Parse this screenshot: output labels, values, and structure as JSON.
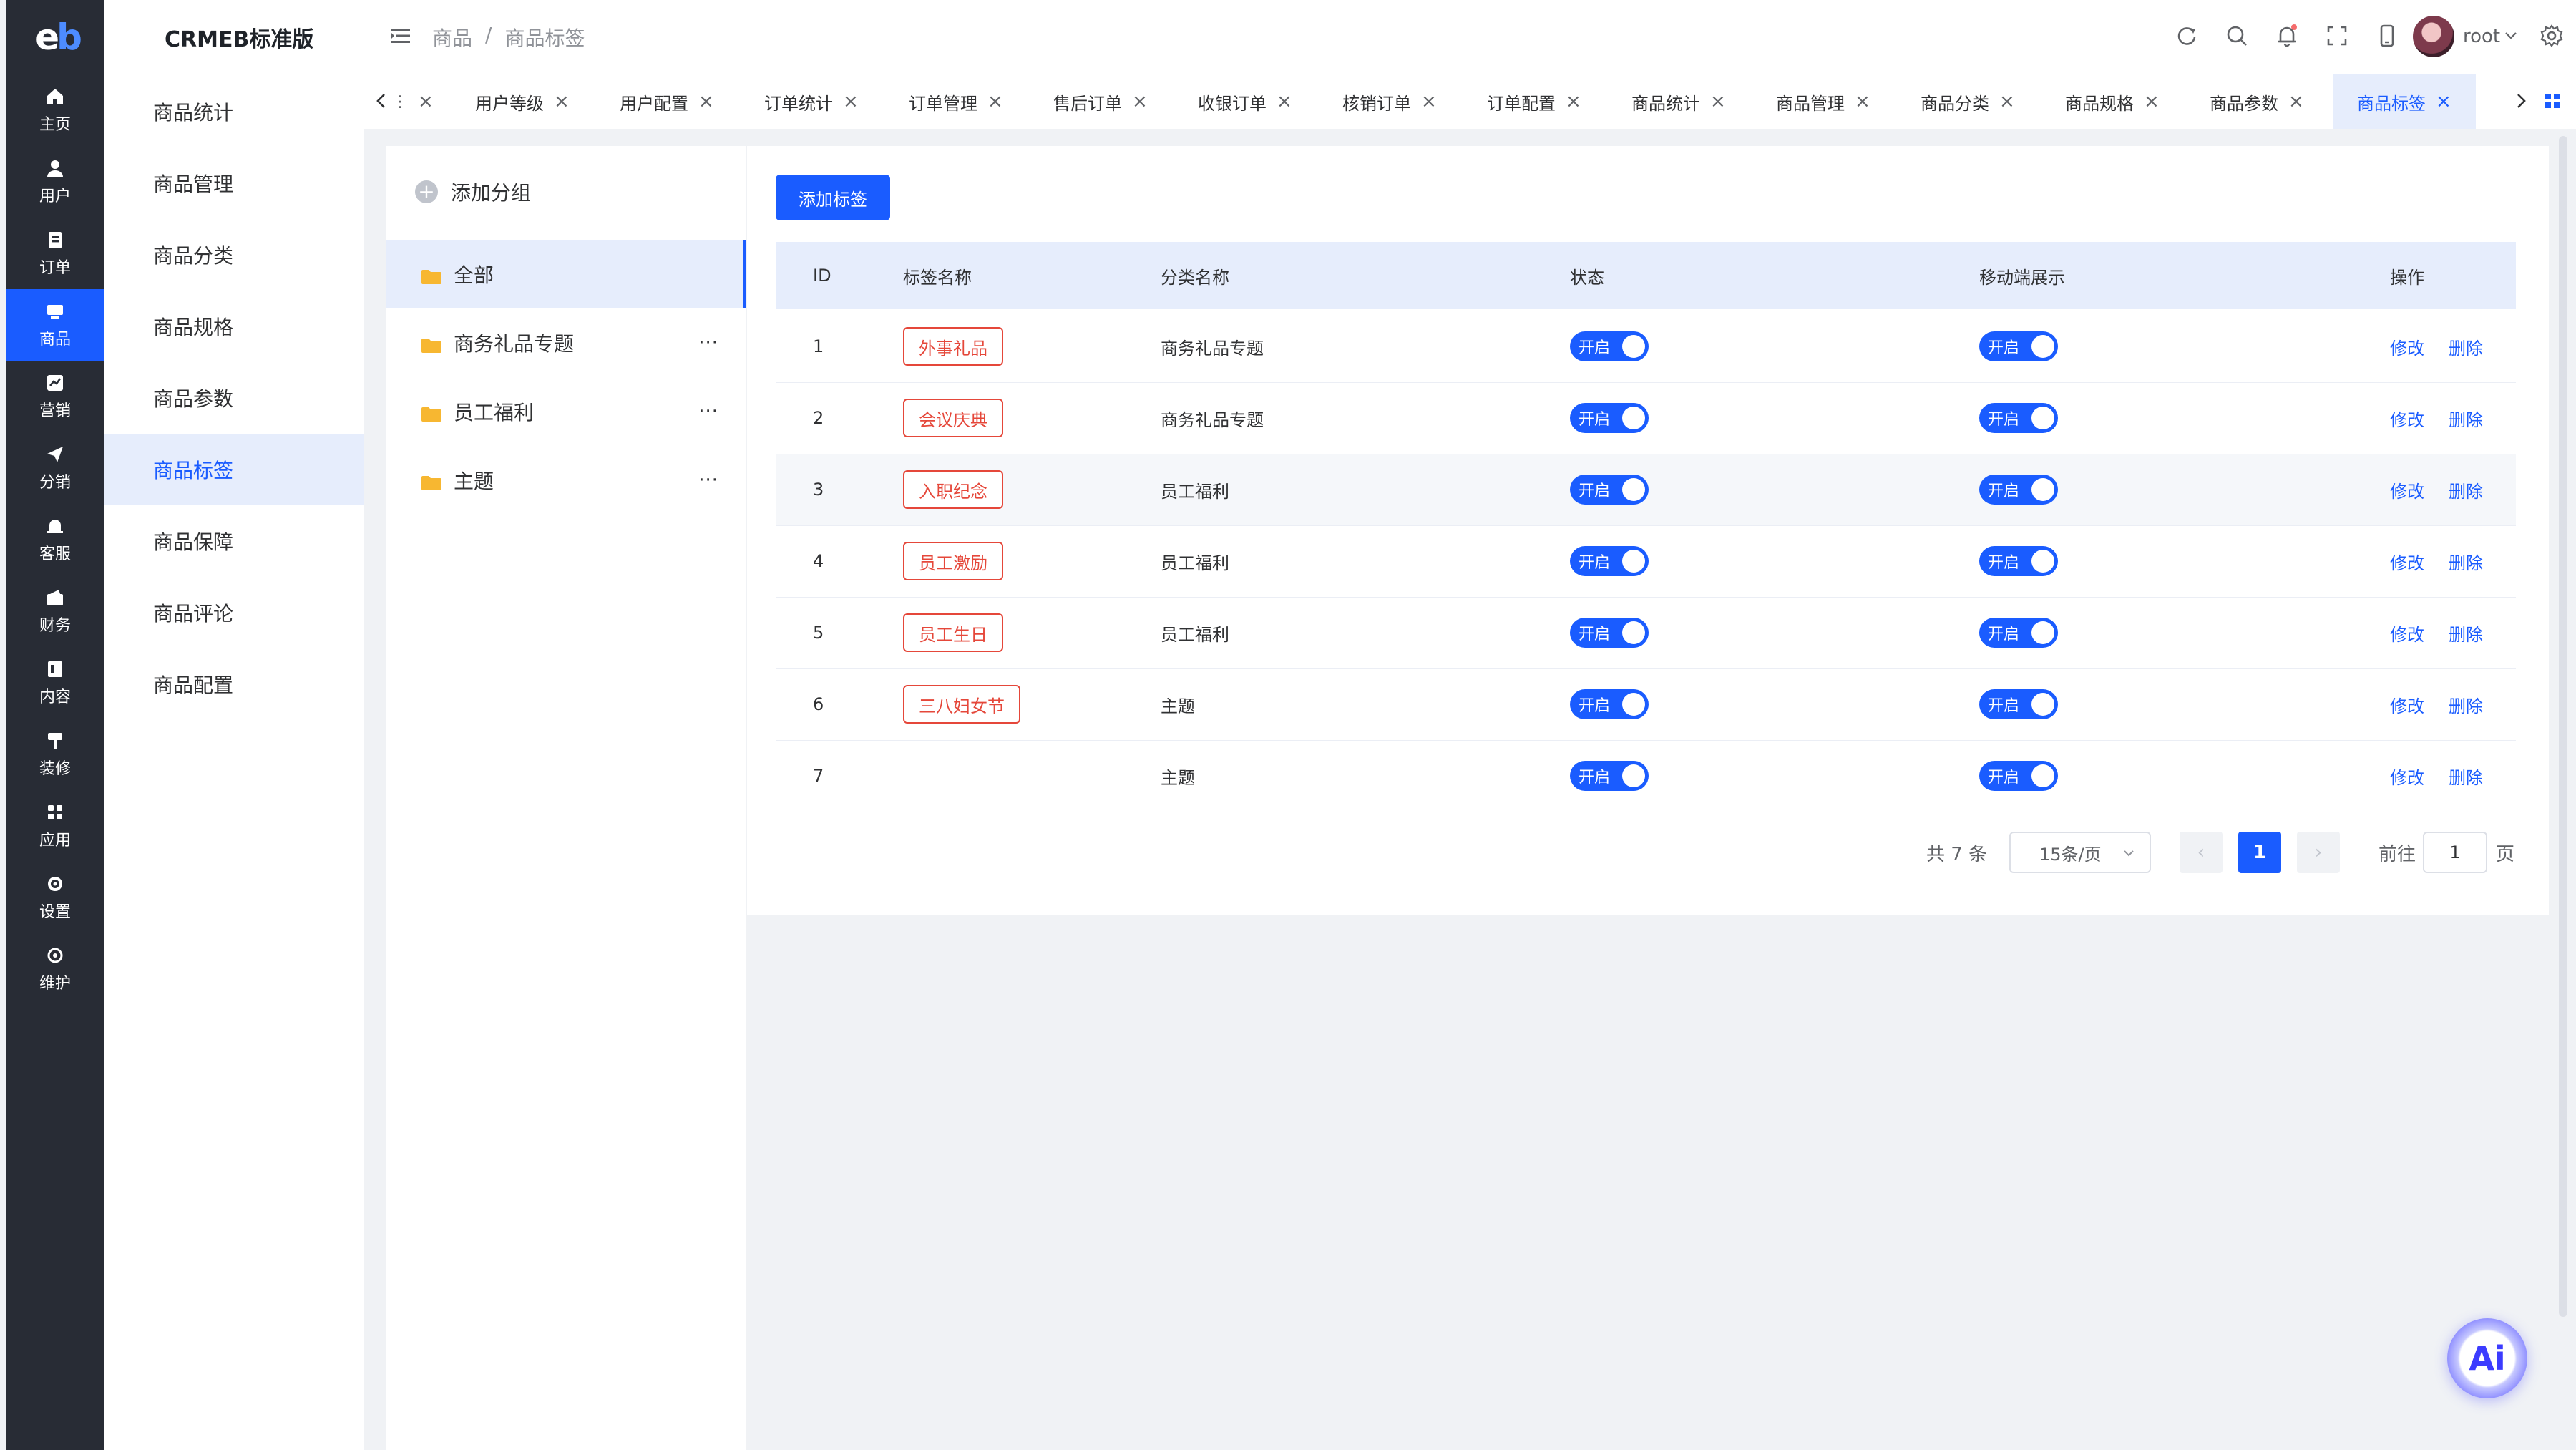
{
  "left_nav": {
    "logo": "eb",
    "items": [
      {
        "label": "主页",
        "icon": "home-icon"
      },
      {
        "label": "用户",
        "icon": "user-icon"
      },
      {
        "label": "订单",
        "icon": "order-icon"
      },
      {
        "label": "商品",
        "icon": "product-icon",
        "active": true
      },
      {
        "label": "营销",
        "icon": "marketing-icon"
      },
      {
        "label": "分销",
        "icon": "distribution-icon"
      },
      {
        "label": "客服",
        "icon": "service-icon"
      },
      {
        "label": "财务",
        "icon": "finance-icon"
      },
      {
        "label": "内容",
        "icon": "content-icon"
      },
      {
        "label": "装修",
        "icon": "decoration-icon"
      },
      {
        "label": "应用",
        "icon": "apps-icon"
      },
      {
        "label": "设置",
        "icon": "settings-icon"
      },
      {
        "label": "维护",
        "icon": "maintenance-icon"
      }
    ]
  },
  "submenu": {
    "brand": "CRMEB标准版",
    "items": [
      "商品统计",
      "商品管理",
      "商品分类",
      "商品规格",
      "商品参数",
      "商品标签",
      "商品保障",
      "商品评论",
      "商品配置"
    ],
    "active": "商品标签"
  },
  "header": {
    "breadcrumb": [
      "商品",
      "/",
      "商品标签"
    ],
    "username": "root",
    "icons": [
      "refresh-icon",
      "search-icon",
      "bell-icon",
      "fullscreen-icon",
      "mobile-icon",
      "settings-icon"
    ]
  },
  "tabs": {
    "items": [
      "用户等级",
      "用户配置",
      "订单统计",
      "订单管理",
      "售后订单",
      "收银订单",
      "核销订单",
      "订单配置",
      "商品统计",
      "商品管理",
      "商品分类",
      "商品规格",
      "商品参数",
      "商品标签"
    ],
    "active": "商品标签",
    "close": "×"
  },
  "groups": {
    "add_label": "添加分组",
    "items": [
      "全部",
      "商务礼品专题",
      "员工福利",
      "主题"
    ],
    "active": "全部",
    "more": "···"
  },
  "table": {
    "add_button": "添加标签",
    "columns": [
      "ID",
      "标签名称",
      "分类名称",
      "状态",
      "移动端展示",
      "操作"
    ],
    "rows": [
      {
        "id": "1",
        "tag": "外事礼品",
        "category": "商务礼品专题",
        "status": "开启",
        "mobile": "开启"
      },
      {
        "id": "2",
        "tag": "会议庆典",
        "category": "商务礼品专题",
        "status": "开启",
        "mobile": "开启"
      },
      {
        "id": "3",
        "tag": "入职纪念",
        "category": "员工福利",
        "status": "开启",
        "mobile": "开启"
      },
      {
        "id": "4",
        "tag": "员工激励",
        "category": "员工福利",
        "status": "开启",
        "mobile": "开启"
      },
      {
        "id": "5",
        "tag": "员工生日",
        "category": "员工福利",
        "status": "开启",
        "mobile": "开启"
      },
      {
        "id": "6",
        "tag": "三八妇女节",
        "category": "主题",
        "status": "开启",
        "mobile": "开启"
      },
      {
        "id": "7",
        "tag": "",
        "category": "主题",
        "status": "开启",
        "mobile": "开启"
      }
    ],
    "edit_label": "修改",
    "delete_label": "删除"
  },
  "pagination": {
    "total": "共 7 条",
    "page_size": "15条/页",
    "current_page": "1",
    "goto_prefix": "前往",
    "goto_value": "1",
    "goto_suffix": "页"
  },
  "ai_button": "Ai",
  "colors": {
    "primary": "#1a5cff",
    "nav_bg": "#282c35",
    "tag_red": "#e5473a",
    "highlight_bg": "#e6edfc"
  }
}
